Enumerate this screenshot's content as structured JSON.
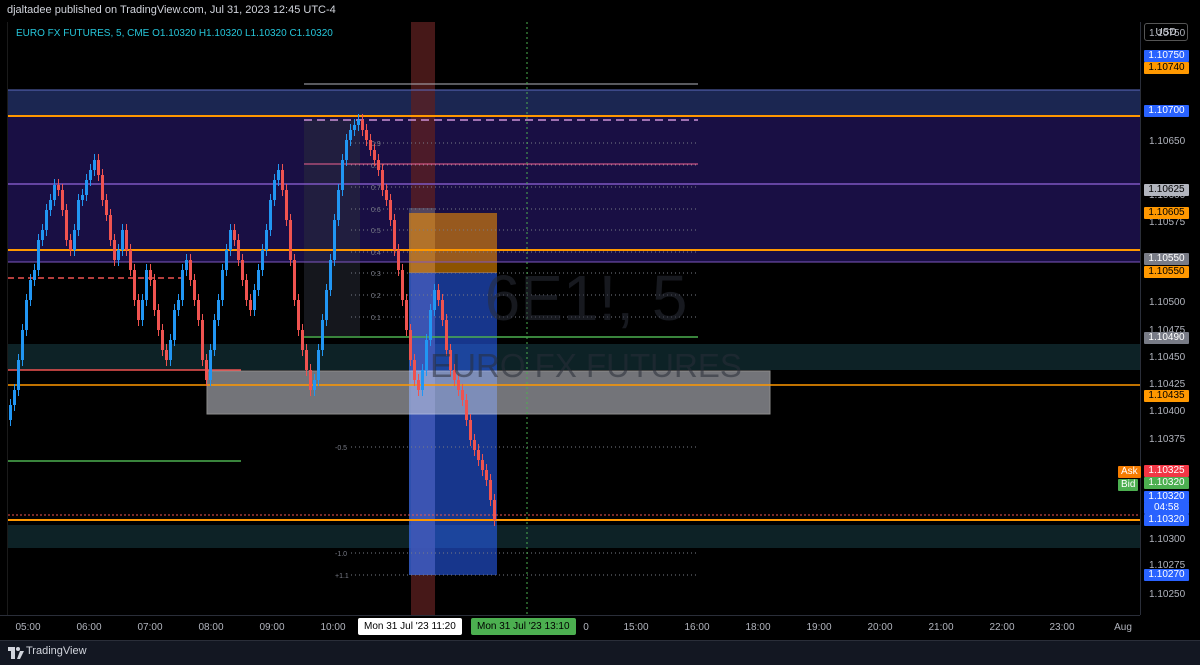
{
  "header": {
    "published": "djaltadee published on TradingView.com, Jul 31, 2023 12:45 UTC-4"
  },
  "symbol": {
    "name": "EURO FX FUTURES",
    "interval": "5",
    "exchange": "CME",
    "legend": "EURO FX FUTURES, 5, CME  O1.10320  H1.10320  L1.10320  C1.10320",
    "watermark_ticker": "6E1!, 5",
    "watermark_name": "EURO FX FUTURES"
  },
  "price_axis": {
    "currency": "USD",
    "ticks": [
      "1.10750",
      "1.10725",
      "1.10675",
      "1.10650",
      "1.10600",
      "1.10575",
      "1.10525",
      "1.10500",
      "1.10475",
      "1.10450",
      "1.10425",
      "1.10400",
      "1.10375",
      "1.10300",
      "1.10275",
      "1.10250"
    ],
    "labels": [
      {
        "text": "1.10750",
        "bg": "#2962ff",
        "fg": "#ffffff"
      },
      {
        "text": "1.10740",
        "bg": "#ff9800",
        "fg": "#000000"
      },
      {
        "text": "1.10700",
        "bg": "#2962ff",
        "fg": "#ffffff"
      },
      {
        "text": "1.10625",
        "bg": "#b2b5be",
        "fg": "#000000"
      },
      {
        "text": "1.10605",
        "bg": "#ff9800",
        "fg": "#000000"
      },
      {
        "text": "1.10550",
        "bg": "#787b86",
        "fg": "#ffffff"
      },
      {
        "text": "1.10550",
        "bg": "#ff9800",
        "fg": "#000000"
      },
      {
        "text": "1.10490",
        "bg": "#787b86",
        "fg": "#ffffff"
      },
      {
        "text": "1.10435",
        "bg": "#ff9800",
        "fg": "#000000"
      },
      {
        "text": "1.10325",
        "bg": "#f23645",
        "fg": "#ffffff"
      },
      {
        "text": "1.10320",
        "bg": "#4caf50",
        "fg": "#ffffff"
      },
      {
        "text": "1.10320",
        "bg": "#2962ff",
        "fg": "#ffffff"
      },
      {
        "text": "04:58",
        "bg": "#2962ff",
        "fg": "#ffffff"
      },
      {
        "text": "1.10320",
        "bg": "#2962ff",
        "fg": "#ffffff"
      },
      {
        "text": "1.10270",
        "bg": "#2962ff",
        "fg": "#ffffff"
      }
    ],
    "ask_label": "Ask",
    "bid_label": "Bid"
  },
  "time_axis": {
    "ticks": [
      "05:00",
      "06:00",
      "07:00",
      "08:00",
      "09:00",
      "10:00",
      "15:00",
      "16:00",
      "18:00",
      "19:00",
      "20:00",
      "21:00",
      "22:00",
      "23:00",
      "Aug"
    ],
    "partial_tick": "0",
    "marker_start": "Mon 31 Jul '23   11:20",
    "marker_end": "Mon 31 Jul '23   13:10"
  },
  "fib_levels": [
    "0.9",
    "0.8",
    "0.7",
    "0.6",
    "0.5",
    "0.4",
    "0.3",
    "0.2",
    "0.1",
    "-0.5",
    "-1.0",
    "+1.1"
  ],
  "colors": {
    "up": "#2196f3",
    "down": "#ef5350",
    "orange_line": "#ff9800",
    "purple_zone": "#1a1048",
    "blue_zone": "#1e2a5a",
    "teal_zone": "#0d2226"
  },
  "footer": {
    "brand": "TradingView"
  }
}
